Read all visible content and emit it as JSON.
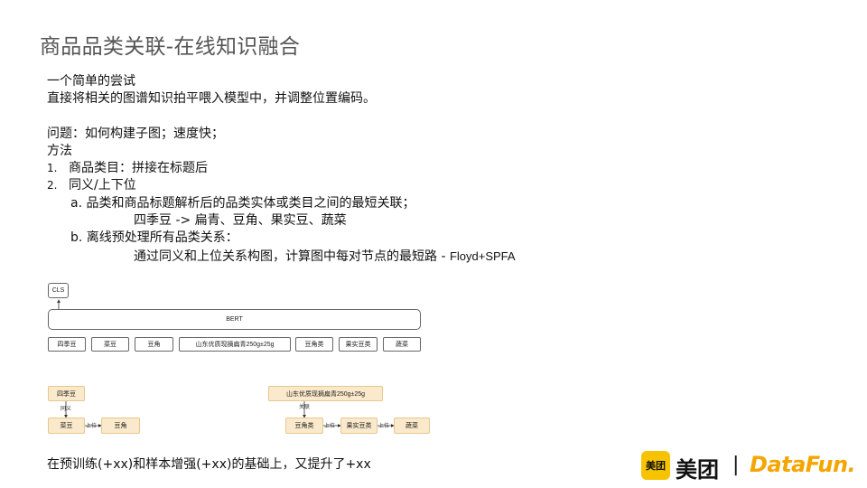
{
  "title": "商品品类关联-在线知识融合",
  "lines": {
    "l1": "一个简单的尝试",
    "l2": "直接将相关的图谱知识拍平喂入模型中，并调整位置编码。",
    "l3": "问题：如何构建子图；速度快；",
    "l4": "方法",
    "l5_num": "1.",
    "l5": "商品类目：拼接在标题后",
    "l6_num": "2.",
    "l6": "同义/上下位",
    "l7": "a. 品类和商品标题解析后的品类实体或类目之间的最短关联；",
    "l8": "四季豆 -> 扁青、豆角、果实豆、蔬菜",
    "l9": "b. 离线预处理所有品类关系：",
    "l10_main": "通过同义和上位关系构图，计算图中每对节点的最短路 - ",
    "l10_tag": "Floyd+SPFA"
  },
  "diagram": {
    "cls": "CLS",
    "bert": "BERT",
    "tokens": [
      "四季豆",
      "菜豆",
      "豆角",
      "山东优质现摘扁青250g±25g",
      "豆角类",
      "果实豆类",
      "蔬菜"
    ],
    "left_graph": {
      "top": "四季豆",
      "edge_label": "同义",
      "bottom_left": "菜豆",
      "relation": "上位",
      "bottom_right": "豆角"
    },
    "right_graph": {
      "top": "山东优质现摘扁青250g±25g",
      "edge_label": "关联",
      "node1": "豆角类",
      "rel1": "上位",
      "node2": "果实豆类",
      "rel2": "上位",
      "node3": "蔬菜"
    }
  },
  "footer": "在预训练(+xx)和样本增强(+xx)的基础上，又提升了+xx",
  "logos": {
    "meituan_badge": "美团",
    "meituan_text": "美团",
    "separator": "|",
    "datafun": "DataFun."
  },
  "colors": {
    "highlight_fill": "#fbe9cc",
    "datafun_orange": "#f5a500",
    "meituan_yellow": "#f7c300"
  }
}
